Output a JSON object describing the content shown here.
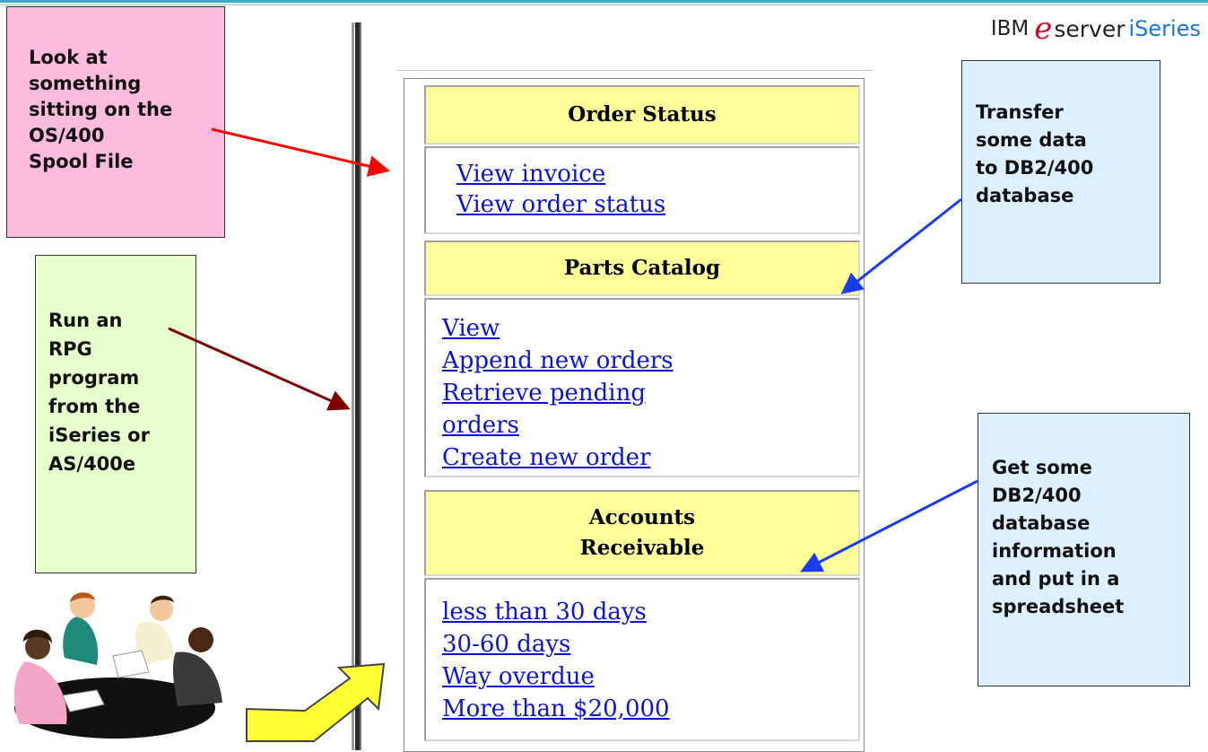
{
  "brand": {
    "ibm": "IBM",
    "e": "e",
    "server": "server",
    "iseries": "iSeries"
  },
  "callouts": {
    "spool": [
      "Look at",
      "something",
      "sitting on the",
      "OS/400",
      "Spool File"
    ],
    "rpg": [
      "Run an",
      "RPG",
      "program",
      "from the",
      "iSeries or",
      "AS/400e"
    ],
    "transfer": [
      "Transfer",
      "some data",
      "to DB2/400",
      "database"
    ],
    "spreadsheet": [
      "Get some",
      "DB2/400",
      "database",
      "information",
      "and put in a",
      "spreadsheet"
    ]
  },
  "menu": {
    "order_status": {
      "heading": "Order Status",
      "links": [
        "View invoice",
        "View order status"
      ]
    },
    "parts_catalog": {
      "heading": "Parts Catalog",
      "links": [
        "View",
        "Append new orders",
        "Retrieve pending",
        "orders",
        "Create new order"
      ]
    },
    "accounts_receivable": {
      "heading": [
        "Accounts",
        "Receivable"
      ],
      "links": [
        "less than 30 days",
        "30-60 days",
        "Way overdue",
        "More than $20,000"
      ]
    }
  },
  "colors": {
    "pink_note": "#ffbbdd",
    "green_note": "#e6ffcc",
    "blue_note": "#ddf0ff",
    "heading_bg": "#ffff99",
    "link": "#0b14d2",
    "brand_e": "#c8102e",
    "brand_iseries": "#1a77d2"
  },
  "icons": {
    "clipart": "business-meeting-clipart",
    "big_arrow": "yellow-curved-arrow"
  }
}
